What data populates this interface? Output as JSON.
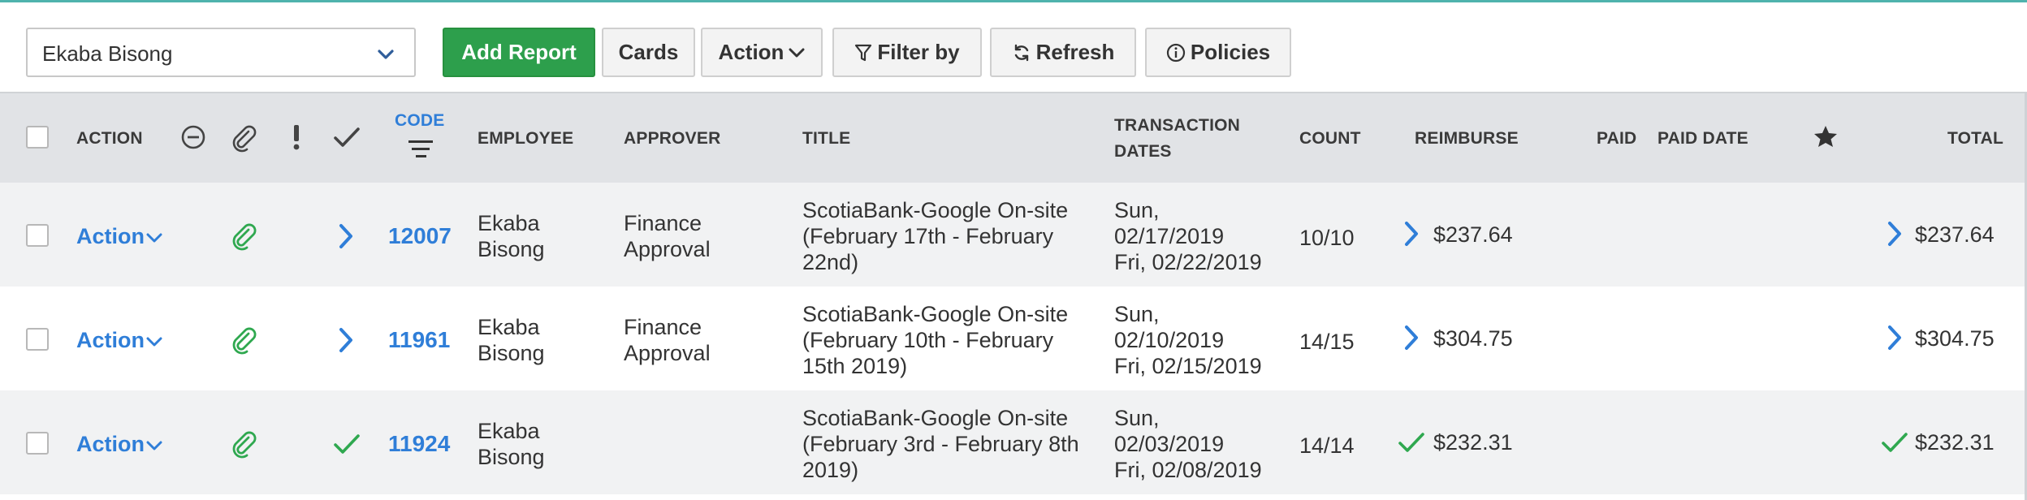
{
  "toolbar": {
    "employee_select_value": "Ekaba Bisong",
    "add_report_label": "Add Report",
    "cards_label": "Cards",
    "action_label": "Action",
    "filter_label": "Filter by",
    "refresh_label": "Refresh",
    "policies_label": "Policies"
  },
  "table": {
    "headers": {
      "action": "ACTION",
      "code": "CODE",
      "employee": "EMPLOYEE",
      "approver": "APPROVER",
      "title": "TITLE",
      "transaction_dates_1": "TRANSACTION",
      "transaction_dates_2": "DATES",
      "count": "COUNT",
      "reimburse": "REIMBURSE",
      "paid": "PAID",
      "paid_date": "PAID DATE",
      "total": "TOTAL"
    },
    "rows": [
      {
        "action": "Action",
        "code": "12007",
        "employee_1": "Ekaba",
        "employee_2": "Bisong",
        "approver_1": "Finance",
        "approver_2": "Approval",
        "title_1": "ScotiaBank-Google On-site",
        "title_2": "(February 17th - February",
        "title_3": "22nd)",
        "date_1": "Sun,",
        "date_2": "02/17/2019",
        "date_3": "Fri, 02/22/2019",
        "count": "10/10",
        "reimburse": "$237.64",
        "total": "$237.64",
        "status_icon": "chevron-right-icon"
      },
      {
        "action": "Action",
        "code": "11961",
        "employee_1": "Ekaba",
        "employee_2": "Bisong",
        "approver_1": "Finance",
        "approver_2": "Approval",
        "title_1": "ScotiaBank-Google On-site",
        "title_2": "(February 10th - February",
        "title_3": "15th 2019)",
        "date_1": "Sun,",
        "date_2": "02/10/2019",
        "date_3": "Fri, 02/15/2019",
        "count": "14/15",
        "reimburse": "$304.75",
        "total": "$304.75",
        "status_icon": "chevron-right-icon"
      },
      {
        "action": "Action",
        "code": "11924",
        "employee_1": "Ekaba",
        "employee_2": "Bisong",
        "approver_1": "",
        "approver_2": "",
        "title_1": "ScotiaBank-Google On-site",
        "title_2": "(February 3rd - February 8th",
        "title_3": "2019)",
        "date_1": "Sun,",
        "date_2": "02/03/2019",
        "date_3": "Fri, 02/08/2019",
        "count": "14/14",
        "reimburse": "$232.31",
        "total": "$232.31",
        "status_icon": "checkmark-icon"
      }
    ]
  },
  "colors": {
    "primary_green": "#2d9f4c",
    "link_blue": "#2f7ed8",
    "attachment_green": "#2fa84f",
    "header_bg": "#e1e3e6",
    "accent_teal": "#4fb3ad"
  }
}
